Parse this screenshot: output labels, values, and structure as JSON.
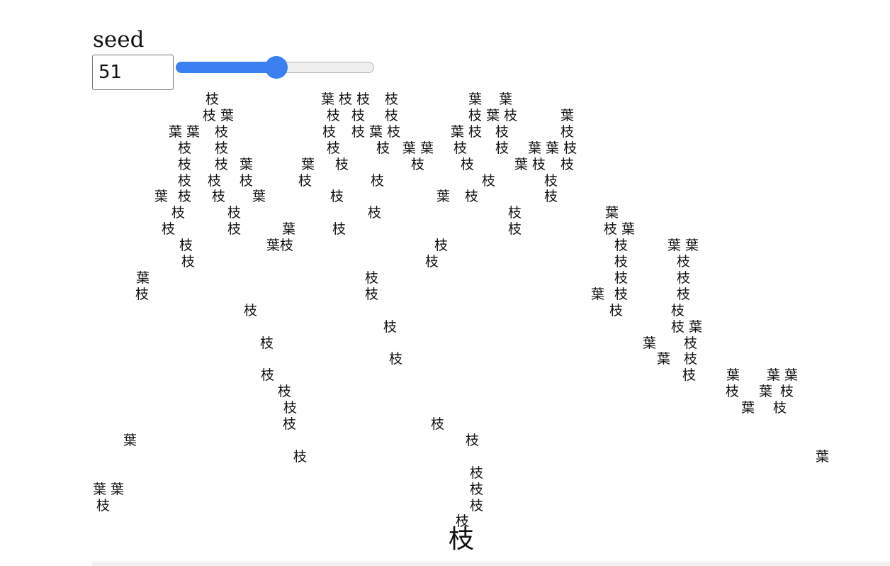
{
  "seed": {
    "label": "seed",
    "value": "51",
    "slider_fraction": 0.51
  },
  "tree": {
    "root": "枝",
    "rows": [
      [
        "枝",
        "葉 枝 枝",
        "枝",
        "葉",
        "葉"
      ],
      [
        "枝 葉",
        "枝",
        "枝",
        "枝",
        "枝 葉 枝",
        "葉"
      ],
      [
        "葉 葉",
        "枝",
        "枝",
        "枝 葉 枝",
        "葉 枝",
        "枝",
        "枝"
      ],
      [
        "枝",
        "枝",
        "枝",
        "枝",
        "葉 葉",
        "枝",
        "枝",
        "葉 葉 枝"
      ],
      [
        "枝",
        "枝",
        "葉",
        "葉",
        "枝",
        "枝",
        "枝",
        "葉 枝",
        "枝"
      ],
      [
        "枝",
        "枝",
        "枝",
        "枝",
        "枝",
        "枝",
        "枝"
      ],
      [
        "葉",
        "枝",
        "枝",
        "葉",
        "枝",
        "葉",
        "枝",
        "枝"
      ],
      [
        "枝",
        "枝",
        "枝",
        "枝",
        "葉"
      ],
      [
        "枝",
        "枝",
        "葉",
        "枝",
        "枝",
        "枝 葉"
      ],
      [
        "枝",
        "葉枝",
        "枝",
        "枝",
        "葉 葉"
      ],
      [
        "枝",
        "枝",
        "枝",
        "枝"
      ],
      [
        "葉",
        "枝",
        "枝",
        "枝"
      ],
      [
        "枝",
        "枝",
        "葉",
        "枝",
        "枝"
      ],
      [
        "枝",
        "枝",
        "枝"
      ],
      [
        "枝",
        "枝 葉"
      ],
      [
        "枝",
        "葉",
        "枝"
      ],
      [
        "枝",
        "葉",
        "枝"
      ],
      [
        "枝",
        "枝",
        "葉",
        "葉 葉"
      ],
      [
        "枝",
        "枝",
        "葉",
        "枝"
      ],
      [
        "枝",
        "葉",
        "枝"
      ],
      [
        "枝",
        "枝"
      ],
      [
        "葉",
        "枝"
      ],
      [
        "枝",
        "葉"
      ],
      [
        "枝"
      ],
      [
        "葉 葉",
        "枝"
      ],
      [
        "枝",
        "枝"
      ],
      [
        "枝"
      ]
    ]
  }
}
